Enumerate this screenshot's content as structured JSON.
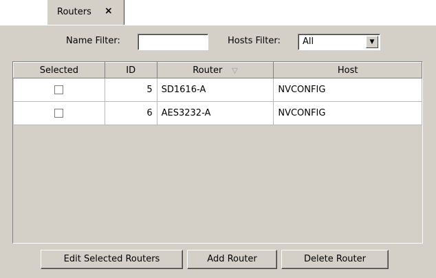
{
  "tab": {
    "label": "Routers",
    "close_glyph": "×"
  },
  "filters": {
    "name_label": "Name Filter:",
    "name_value": "",
    "hosts_label": "Hosts Filter:",
    "hosts_value": "All"
  },
  "table": {
    "columns": [
      "Selected",
      "ID",
      "Router",
      "Host"
    ],
    "sort_glyph": "▽",
    "rows": [
      {
        "selected": false,
        "id": "5",
        "router": "SD1616-A",
        "host": "NVCONFIG"
      },
      {
        "selected": false,
        "id": "6",
        "router": "AES3232-A",
        "host": "NVCONFIG"
      }
    ]
  },
  "buttons": {
    "edit": "Edit Selected Routers",
    "add": "Add Router",
    "delete": "Delete Router"
  }
}
